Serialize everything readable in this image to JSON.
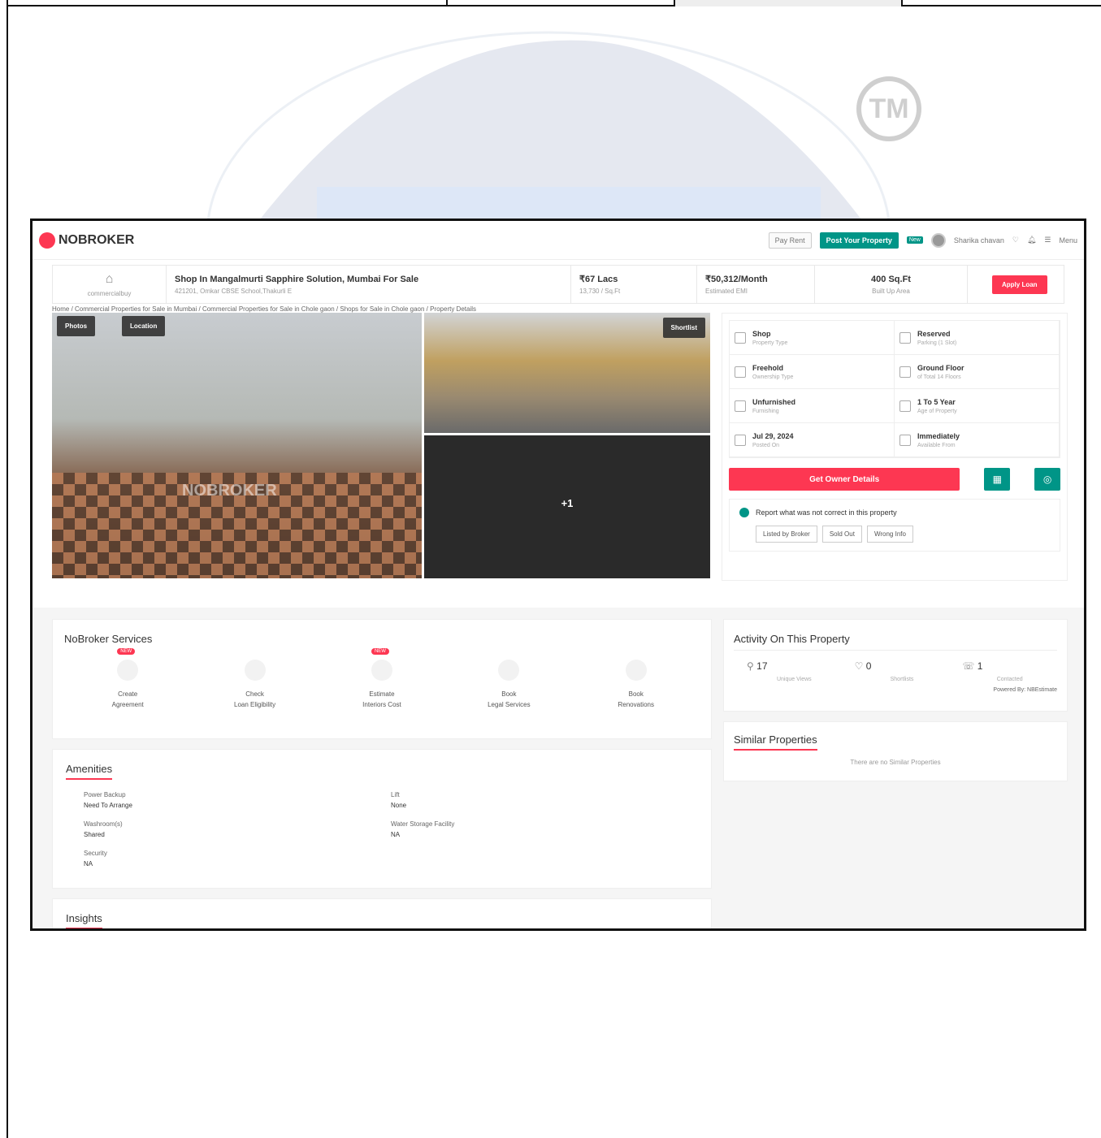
{
  "watermark": {
    "tm": "TM"
  },
  "navbar": {
    "logo": "NOBROKER",
    "pay_rent": "Pay Rent",
    "post_property": "Post Your Property",
    "new_badge": "New",
    "user_name": "Sharika chavan",
    "menu": "Menu"
  },
  "header": {
    "category": "commercialbuy",
    "title": "Shop In Mangalmurti Sapphire Solution, Mumbai For Sale",
    "address": "421201, Omkar CBSE School,Thakurli E",
    "price": "₹67 Lacs",
    "price_sub": "13,730 / Sq.Ft",
    "emi": "₹50,312/Month",
    "emi_sub": "Estimated EMI",
    "area": "400 Sq.Ft",
    "area_sub": "Built Up Area",
    "apply_loan": "Apply Loan"
  },
  "breadcrumb": "Home / Commercial Properties for Sale in Mumbai / Commercial Properties for Sale in Chole gaon / Shops for Sale in Chole gaon / Property Details",
  "gallery": {
    "photos_btn": "Photos",
    "location_btn": "Location",
    "shortlist_btn": "Shortlist",
    "more_count": "+1",
    "watermark": "NOBROKER"
  },
  "details": [
    {
      "value": "Shop",
      "label": "Property Type",
      "icon": "building-icon"
    },
    {
      "value": "Reserved",
      "label": "Parking (1 Slot)",
      "icon": "parking-icon"
    },
    {
      "value": "Freehold",
      "label": "Ownership Type",
      "icon": "ownership-icon"
    },
    {
      "value": "Ground Floor",
      "label": "of Total 14 Floors",
      "icon": "floor-icon"
    },
    {
      "value": "Unfurnished",
      "label": "Furnishing",
      "icon": "furnishing-icon"
    },
    {
      "value": "1 To 5 Year",
      "label": "Age of Property",
      "icon": "age-icon"
    },
    {
      "value": "Jul 29, 2024",
      "label": "Posted On",
      "icon": "flag-icon"
    },
    {
      "value": "Immediately",
      "label": "Available From",
      "icon": "calendar-icon"
    }
  ],
  "actions": {
    "owner_btn": "Get Owner Details"
  },
  "report": {
    "text": "Report what was not correct in this property",
    "options": [
      "Listed by Broker",
      "Sold Out",
      "Wrong Info"
    ]
  },
  "services": {
    "title": "NoBroker Services",
    "items": [
      {
        "line1": "Create",
        "line2": "Agreement",
        "new": "NEW"
      },
      {
        "line1": "Check",
        "line2": "Loan Eligibility",
        "new": ""
      },
      {
        "line1": "Estimate",
        "line2": "Interiors Cost",
        "new": "NEW"
      },
      {
        "line1": "Book",
        "line2": "Legal Services",
        "new": ""
      },
      {
        "line1": "Book",
        "line2": "Renovations",
        "new": ""
      }
    ]
  },
  "amenities": {
    "title": "Amenities",
    "items": [
      {
        "name": "Power Backup",
        "value": "Need To Arrange"
      },
      {
        "name": "Lift",
        "value": "None"
      },
      {
        "name": "Washroom(s)",
        "value": "Shared"
      },
      {
        "name": "Water Storage Facility",
        "value": "NA"
      },
      {
        "name": "Security",
        "value": "NA"
      }
    ]
  },
  "insights": {
    "title": "Insights"
  },
  "activity": {
    "title": "Activity On This Property",
    "stats": [
      {
        "value": "17",
        "label": "Unique Views"
      },
      {
        "value": "0",
        "label": "Shortlists"
      },
      {
        "value": "1",
        "label": "Contacted"
      }
    ],
    "powered": "Powered By: NBEstimate"
  },
  "similar": {
    "title": "Similar Properties",
    "empty": "There are no Similar Properties"
  }
}
